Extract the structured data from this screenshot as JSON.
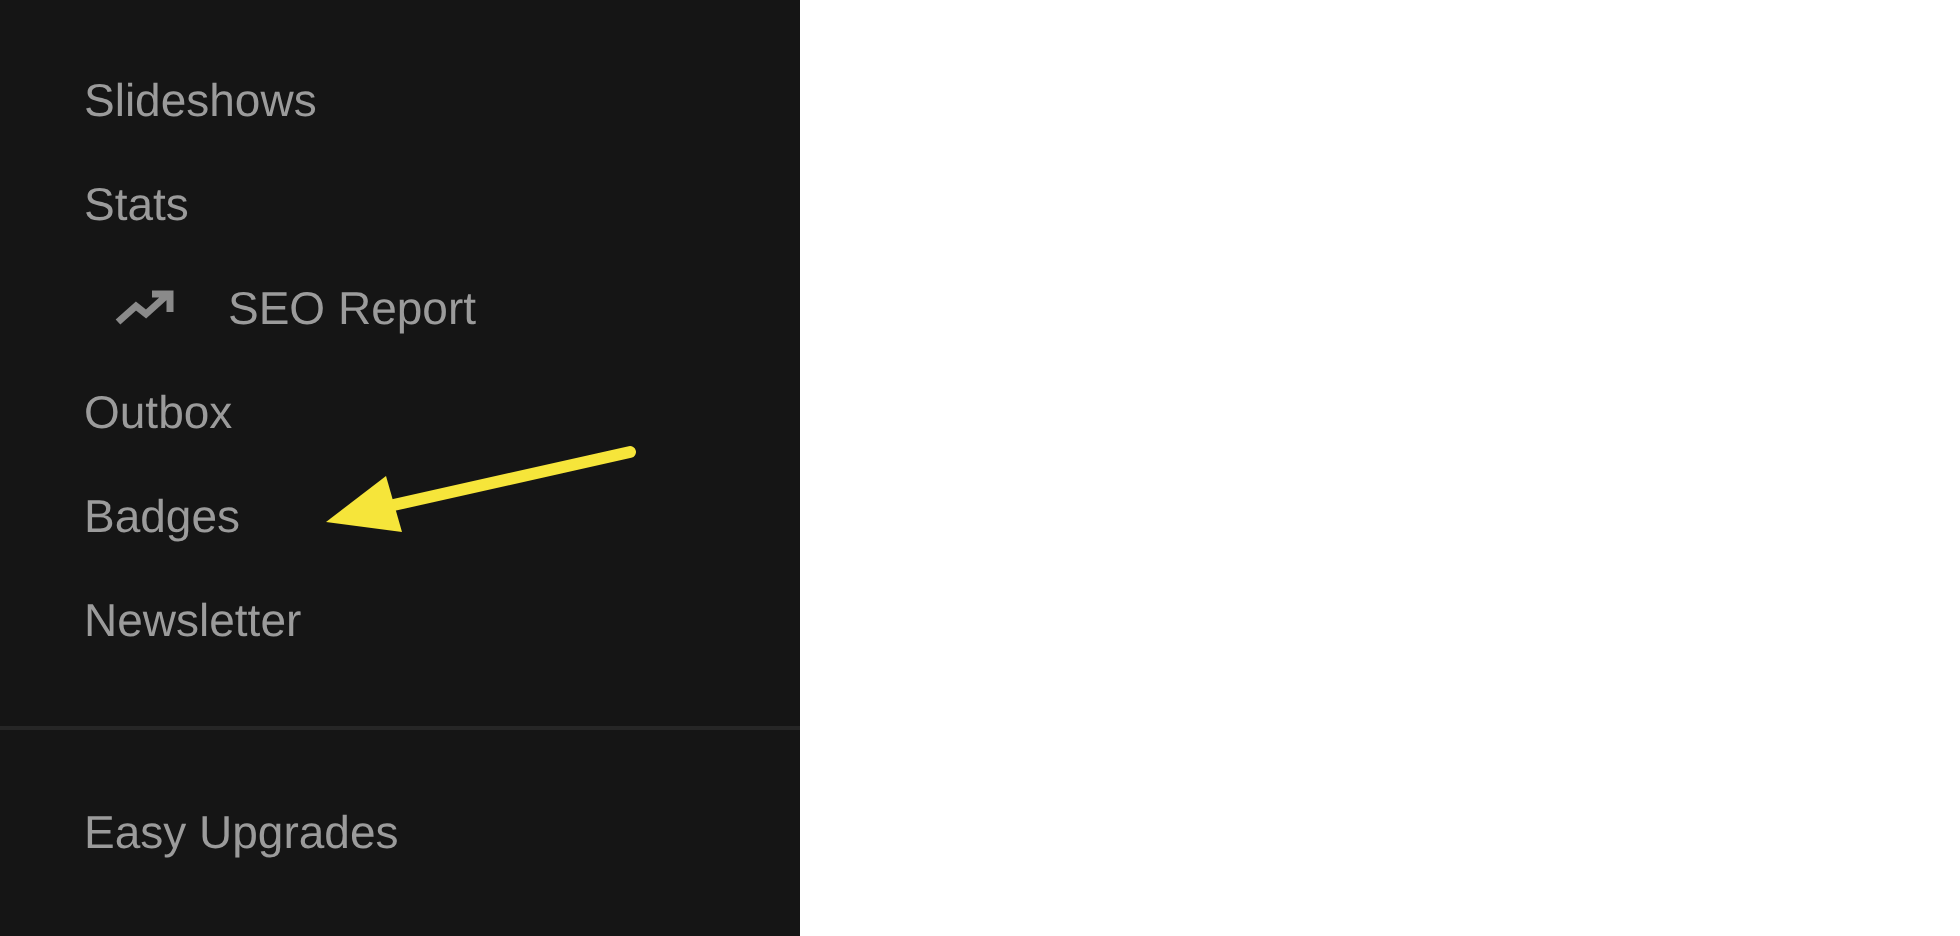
{
  "sidebar": {
    "sections": [
      {
        "items": [
          {
            "label": "Slideshows"
          },
          {
            "label": "Stats",
            "children": [
              {
                "label": "SEO Report"
              }
            ]
          },
          {
            "label": "Outbox"
          },
          {
            "label": "Badges"
          },
          {
            "label": "Newsletter"
          }
        ]
      },
      {
        "items": [
          {
            "label": "Easy Upgrades"
          }
        ]
      }
    ]
  },
  "annotations": [
    {
      "kind": "arrow"
    }
  ]
}
